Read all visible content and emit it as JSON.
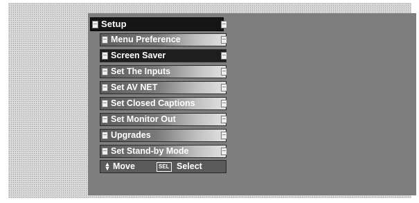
{
  "menu": {
    "title": "Setup",
    "items": [
      {
        "label": "Menu Preference",
        "selected": false
      },
      {
        "label": "Screen Saver",
        "selected": true
      },
      {
        "label": "Set The Inputs",
        "selected": false
      },
      {
        "label": "Set AV NET",
        "selected": false
      },
      {
        "label": "Set Closed Captions",
        "selected": false
      },
      {
        "label": "Set Monitor Out",
        "selected": false
      },
      {
        "label": "Upgrades",
        "selected": false
      },
      {
        "label": "Set Stand-by Mode",
        "selected": false
      }
    ]
  },
  "hints": {
    "move_label": "Move",
    "move_icon": "up-down-arrows-icon",
    "select_key": "SEL",
    "select_label": "Select"
  }
}
